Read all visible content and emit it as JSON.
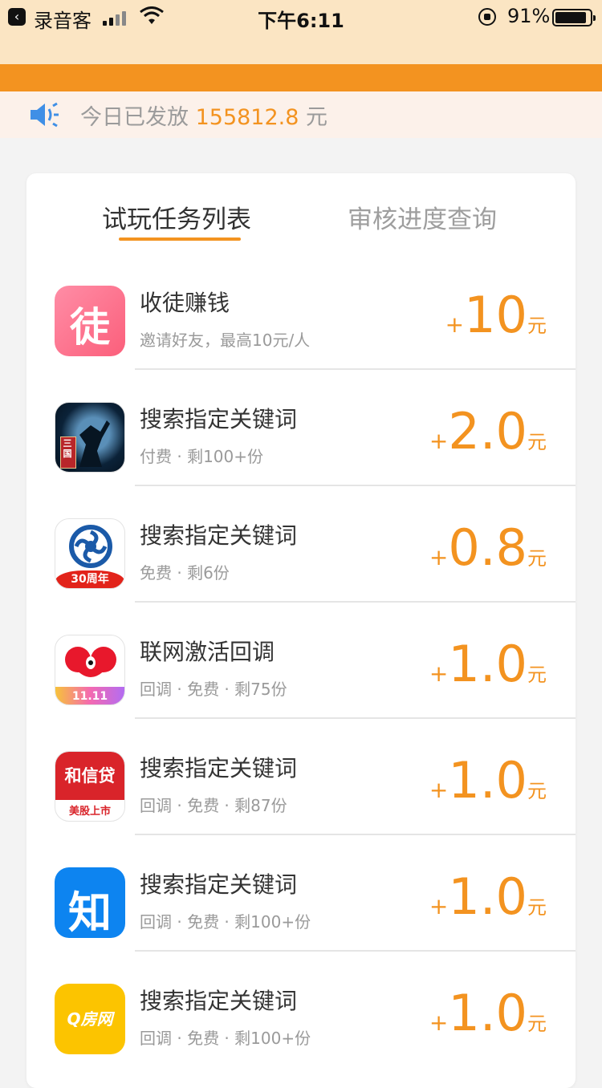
{
  "status_bar": {
    "back_app": "录音客",
    "time": "下午6:11",
    "battery_pct": "91%",
    "battery_level": 0.91
  },
  "notice": {
    "prefix": "今日已发放",
    "amount": "155812.8",
    "suffix": "元"
  },
  "tabs": [
    {
      "label": "试玩任务列表",
      "active": true
    },
    {
      "label": "审核进度查询",
      "active": false
    }
  ],
  "tasks": [
    {
      "icon": "tu-apprentice-icon",
      "icon_text": "徒",
      "title": "收徒赚钱",
      "subtitle": "邀请好友，最高10元/人",
      "plus": "+",
      "amount": "10",
      "unit": "元"
    },
    {
      "icon": "three-kingdoms-game-icon",
      "icon_text": "三国",
      "title": "搜索指定关键词",
      "subtitle": "付费 · 剩100+份",
      "plus": "+",
      "amount": "2.0",
      "unit": "元"
    },
    {
      "icon": "bank-30th-anniversary-icon",
      "icon_text": "30周年",
      "title": "搜索指定关键词",
      "subtitle": "免费 · 剩6份",
      "plus": "+",
      "amount": "0.8",
      "unit": "元"
    },
    {
      "icon": "koala-11-11-icon",
      "icon_text": "11.11",
      "title": "联网激活回调",
      "subtitle": "回调 · 免费 · 剩75份",
      "plus": "+",
      "amount": "1.0",
      "unit": "元"
    },
    {
      "icon": "hexindai-icon",
      "icon_text": "和信贷",
      "icon_text2": "美股上市",
      "title": "搜索指定关键词",
      "subtitle": "回调 · 免费 · 剩87份",
      "plus": "+",
      "amount": "1.0",
      "unit": "元"
    },
    {
      "icon": "zhihu-icon",
      "icon_text": "知",
      "title": "搜索指定关键词",
      "subtitle": "回调 · 免费 · 剩100+份",
      "plus": "+",
      "amount": "1.0",
      "unit": "元"
    },
    {
      "icon": "qfang-icon",
      "icon_text": "Q房网",
      "title": "搜索指定关键词",
      "subtitle": "回调 · 免费 · 剩100+份",
      "plus": "+",
      "amount": "1.0",
      "unit": "元"
    }
  ],
  "colors": {
    "accent": "#f39320",
    "header_bg": "#fbe5c3",
    "notice_bg": "#fcf1ea"
  }
}
